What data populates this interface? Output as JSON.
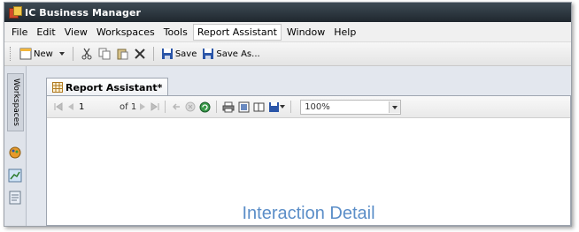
{
  "window": {
    "title": "IC Business Manager"
  },
  "menu": {
    "items": [
      "File",
      "Edit",
      "View",
      "Workspaces",
      "Tools",
      "Report Assistant",
      "Window",
      "Help"
    ],
    "active_index": 5
  },
  "toolbar": {
    "new_label": "New",
    "save_label": "Save",
    "save_as_label": "Save As..."
  },
  "rail": {
    "workspaces_label": "Workspaces"
  },
  "document": {
    "tab_label": "Report Assistant*",
    "report_toolbar": {
      "page_value": "1",
      "of_text": "of 1",
      "zoom_value": "100%"
    },
    "report_title": "Interaction Detail"
  },
  "colors": {
    "titlebar": "#2b343c",
    "report_title": "#5b8ec8",
    "save_icon": "#2a55a8"
  },
  "icons": {
    "app": "app-logo-icon",
    "new": "new-document-icon",
    "cut": "cut-icon",
    "copy": "copy-icon",
    "paste": "paste-icon",
    "delete": "delete-x-icon",
    "save": "save-disk-icon",
    "print": "printer-icon"
  }
}
